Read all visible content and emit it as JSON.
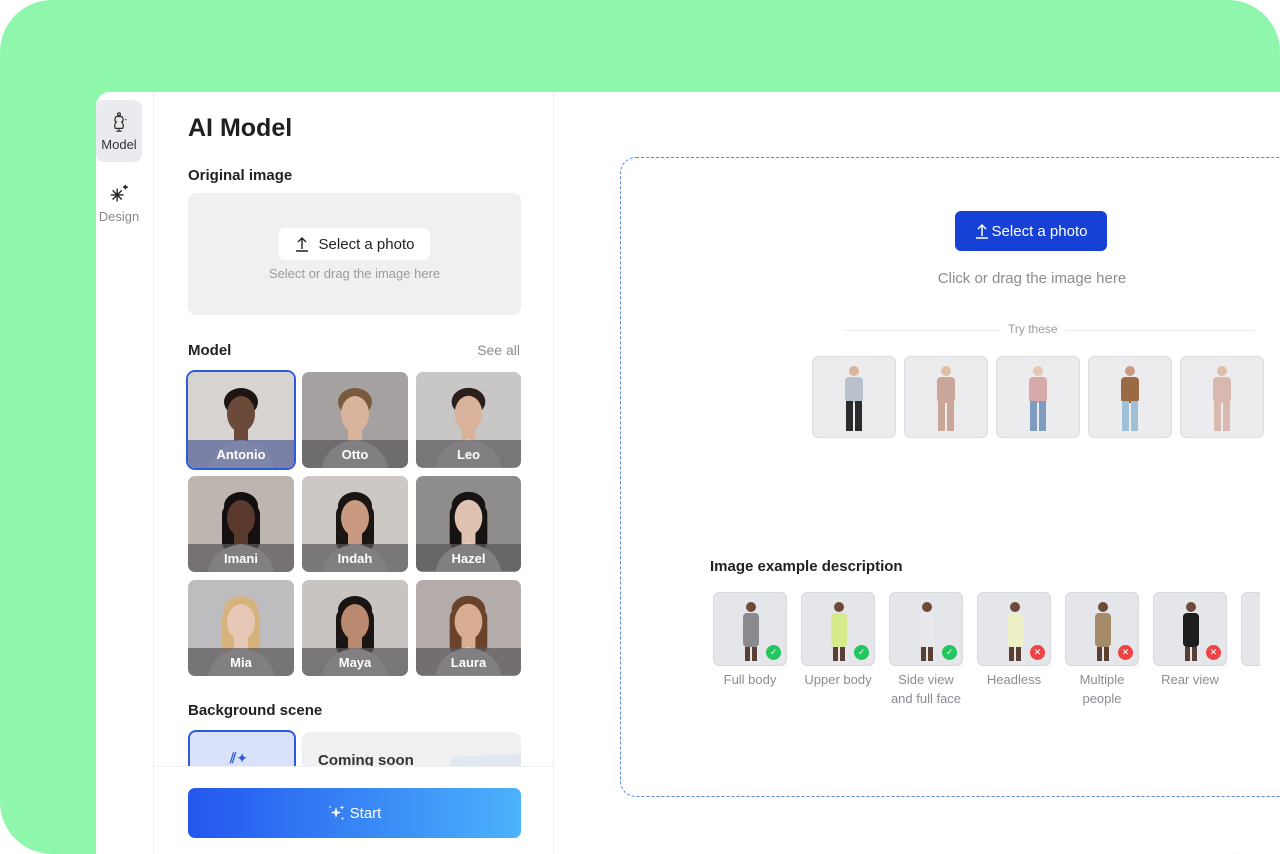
{
  "rail": {
    "items": [
      {
        "label": "Model",
        "icon": "dress-form-icon",
        "active": true
      },
      {
        "label": "Design",
        "icon": "magic-wand-sparkle-icon",
        "active": false
      }
    ]
  },
  "panel": {
    "title": "AI Model",
    "original_image": {
      "label": "Original image",
      "button": "Select a photo",
      "hint": "Select or drag the image here"
    },
    "model": {
      "label": "Model",
      "see_all": "See all",
      "selected": "Antonio",
      "items": [
        {
          "name": "Antonio",
          "skin": "#6b4a3a",
          "hair": "#1c1512",
          "bg": "#d6d3d1"
        },
        {
          "name": "Otto",
          "skin": "#d9b49c",
          "hair": "#7a5a3c",
          "bg": "#a6a2a1"
        },
        {
          "name": "Leo",
          "skin": "#d8b29a",
          "hair": "#2a1f1a",
          "bg": "#c9c7c6"
        },
        {
          "name": "Imani",
          "skin": "#5a3a2c",
          "hair": "#141010",
          "bg": "#bdb6b0"
        },
        {
          "name": "Indah",
          "skin": "#c99a80",
          "hair": "#1a1412",
          "bg": "#cdc8c3"
        },
        {
          "name": "Hazel",
          "skin": "#e0c2b2",
          "hair": "#171313",
          "bg": "#8f8d8c"
        },
        {
          "name": "Mia",
          "skin": "#e7c8b6",
          "hair": "#d6b27c",
          "bg": "#bdbdbf"
        },
        {
          "name": "Maya",
          "skin": "#b98a70",
          "hair": "#1a1412",
          "bg": "#c7c4c2"
        },
        {
          "name": "Laura",
          "skin": "#d9ad92",
          "hair": "#6a432c",
          "bg": "#b3acaa"
        }
      ]
    },
    "background_scene": {
      "label": "Background scene",
      "ai_option_icon": "ai-sparkle-icon",
      "coming_soon": "Coming soon"
    },
    "start_button": "Start"
  },
  "main": {
    "upload_button": "Select a photo",
    "hint": "Click or drag the image here",
    "try_these_label": "Try these",
    "try_items": [
      {
        "desc": "man grey sweater black pants",
        "top": "#b9c2cc",
        "bottom": "#2b2b2d",
        "skin": "#d9b49c"
      },
      {
        "desc": "woman pink shirt dress",
        "top": "#c9a59a",
        "bottom": "#c9a59a",
        "skin": "#e0bfa7"
      },
      {
        "desc": "woman pink top jeans",
        "top": "#d6a9ab",
        "bottom": "#7d9cc0",
        "skin": "#e6c6b2"
      },
      {
        "desc": "man brown coat jeans",
        "top": "#9a6a44",
        "bottom": "#9fc1d8",
        "skin": "#c99a80"
      },
      {
        "desc": "woman floral dress",
        "top": "#d9b8b0",
        "bottom": "#d9b8b0",
        "skin": "#e0bfa7"
      }
    ],
    "examples": {
      "title": "Image example description",
      "items": [
        {
          "label": "Full body",
          "ok": true,
          "color": "#8a8a8c"
        },
        {
          "label": "Upper body",
          "ok": true,
          "color": "#d6ec8c"
        },
        {
          "label": "Side view and full face",
          "ok": true,
          "color": "#e8e8ea"
        },
        {
          "label": "Headless",
          "ok": false,
          "color": "#eef0c8"
        },
        {
          "label": "Multiple people",
          "ok": false,
          "color": "#a58a6a"
        },
        {
          "label": "Rear view",
          "ok": false,
          "color": "#1e1e20"
        },
        {
          "label": "",
          "ok": false,
          "color": "#d6d8dc"
        }
      ],
      "ok_color": "#22c55e",
      "bad_color": "#ef4444"
    }
  },
  "colors": {
    "background": "#8ef7ab",
    "accent": "#1640d6",
    "selected_outline": "#2f5bd8"
  }
}
